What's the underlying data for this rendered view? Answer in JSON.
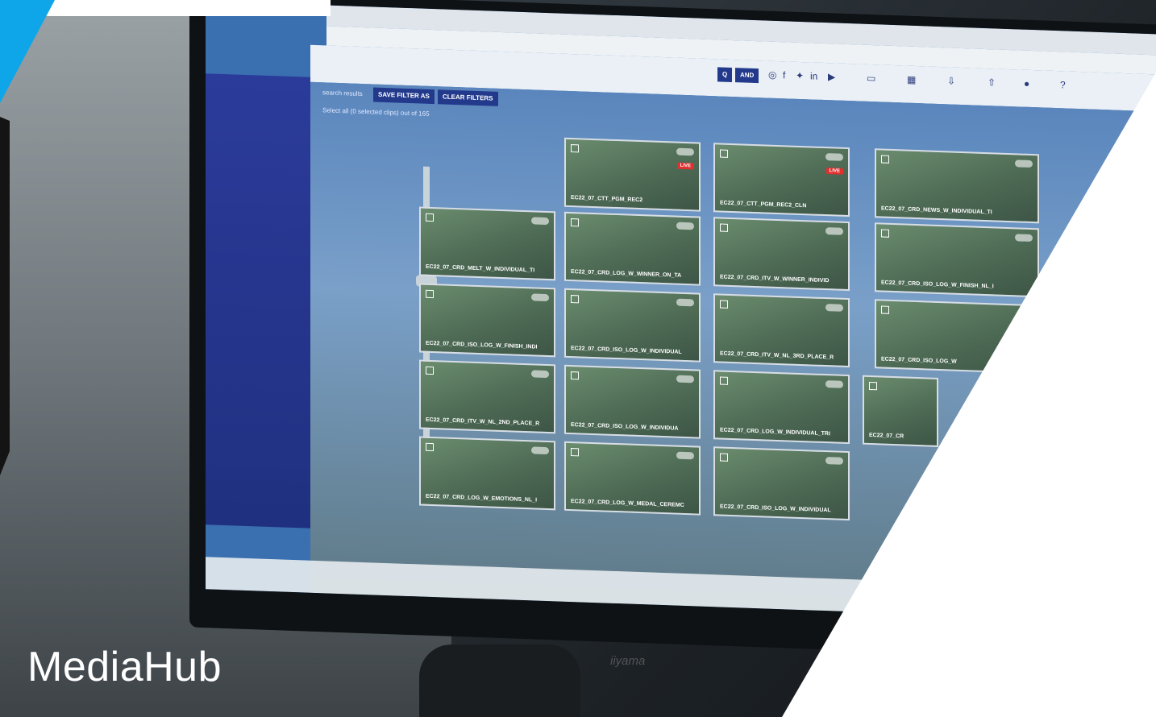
{
  "brand": {
    "title": "MediaHub",
    "accent_color": "#0ea5e9"
  },
  "app": {
    "toolbar": {
      "search_btn": "Q",
      "and_btn": "AND"
    },
    "search": {
      "label": "search results",
      "save_filter": "SAVE FILTER AS",
      "clear_filters": "CLEAR FILTERS",
      "select_all": "Select all (0 selected clips) out of 165"
    },
    "tiles": [
      {
        "name": "EC22_07_CTT_PGM_REC2",
        "live": "LIVE"
      },
      {
        "name": "EC22_07_CTT_PGM_REC2_CLN",
        "live": "LIVE"
      },
      {
        "name": "EC22_07_CRD_NEWS_W_INDIVIDUAL_TI"
      },
      {
        "name": "EC22_07_CRD_MELT_W_INDIVIDUAL_TI"
      },
      {
        "name": "EC22_07_CRD_LOG_W_WINNER_ON_TA"
      },
      {
        "name": "EC22_07_CRD_ITV_W_WINNER_INDIVID"
      },
      {
        "name": "EC22_07_CRD_ISO_LOG_W_FINISH_NL_I"
      },
      {
        "name": "EC22_07_CRD_ISO_LOG_W_FINISH_INDI"
      },
      {
        "name": "EC22_07_CRD_ISO_LOG_W_INDIVIDUAL"
      },
      {
        "name": "EC22_07_CRD_ITV_W_NL_3RD_PLACE_R"
      },
      {
        "name": "EC22_07_CRD_ISO_LOG_W"
      },
      {
        "name": "EC22_07_CRD_ITV_W_NL_2ND_PLACE_R"
      },
      {
        "name": "EC22_07_CRD_ISO_LOG_W_INDIVIDUA"
      },
      {
        "name": "EC22_07_CRD_LOG_W_INDIVIDUAL_TRI"
      },
      {
        "name": "EC22_07_CR"
      },
      {
        "name": "EC22_07_CRD_LOG_W_EMOTIONS_NL_I"
      },
      {
        "name": "EC22_07_CRD_LOG_W_MEDAL_CEREMC"
      },
      {
        "name": "EC22_07_CRD_ISO_LOG_W_INDIVIDUAL"
      }
    ]
  },
  "monitor": {
    "brand": "iiyama"
  }
}
